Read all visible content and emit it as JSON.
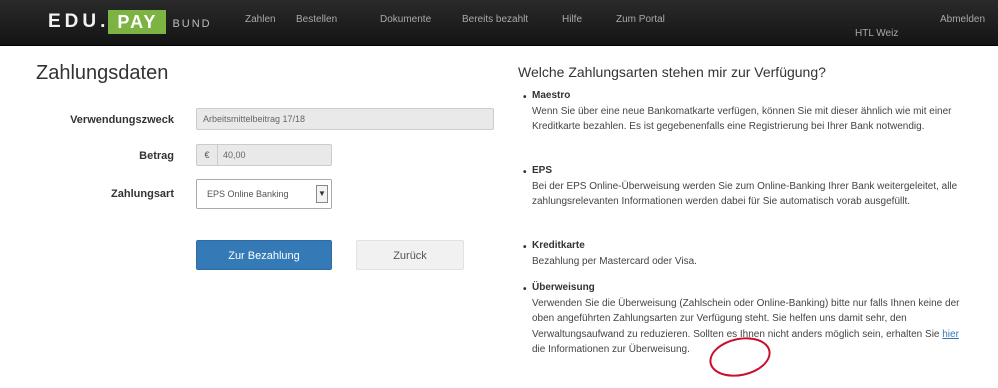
{
  "nav": {
    "logo": {
      "edu": "EDU",
      "dot": ".",
      "pay": "PAY",
      "bund": "BUND"
    },
    "links": [
      "Zahlen",
      "Bestellen",
      "Dokumente",
      "Bereits bezahlt",
      "Hilfe",
      "Zum Portal"
    ],
    "school": "HTL Weiz",
    "logout": "Abmelden"
  },
  "form": {
    "title": "Zahlungsdaten",
    "purpose_label": "Verwendungszweck",
    "purpose_value": "Arbeitsmittelbeitrag 17/18",
    "amount_label": "Betrag",
    "amount_prefix": "€",
    "amount_value": "40,00",
    "method_label": "Zahlungsart",
    "method_value": "EPS Online Banking",
    "pay_button": "Zur Bezahlung",
    "back_button": "Zurück"
  },
  "info": {
    "title": "Welche Zahlungsarten stehen mir zur Verfügung?",
    "options": [
      {
        "name": "Maestro",
        "text": "Wenn Sie über eine neue Bankomatkarte verfügen, können Sie mit dieser ähnlich wie mit einer Kreditkarte bezahlen. Es ist gegebenenfalls eine Registrierung bei Ihrer Bank notwendig."
      },
      {
        "name": "EPS",
        "text": "Bei der EPS Online-Überweisung werden Sie zum Online-Banking Ihrer Bank weitergeleitet, alle zahlungsrelevanten Informationen werden dabei für Sie automatisch vorab ausgefüllt."
      },
      {
        "name": "Kreditkarte",
        "text": "Bezahlung per Mastercard oder Visa."
      },
      {
        "name": "Überweisung",
        "text_before": "Verwenden Sie die Überweisung (Zahlschein oder Online-Banking) bitte nur falls Ihnen keine der oben angeführten Zahlungsarten zur Verfügung steht. Sie helfen uns damit sehr, den Verwaltungsaufwand zu reduzieren. Sollten es Ihnen nicht anders möglich sein, erhalten Sie ",
        "link": "hier",
        "text_after": " die Informationen zur Überweisung."
      }
    ]
  },
  "colors": {
    "nav_bg": "#1c1c1c",
    "brand_green": "#7cb342",
    "primary": "#337ab7",
    "annotation": "#c8102e"
  }
}
